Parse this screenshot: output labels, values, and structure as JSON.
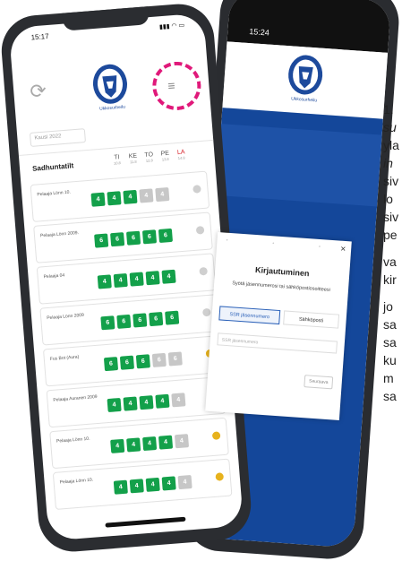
{
  "front_phone": {
    "status_time": "15:17",
    "signal": "...",
    "logo_label": "Ukkosurheilu",
    "menu_icon": "hamburger-menu-icon",
    "refresh_icon": "refresh-icon",
    "season_select": "Kausi 2022",
    "table_title": "Sadhuntatilt",
    "days": [
      {
        "label": "TI",
        "date": "10.8"
      },
      {
        "label": "KE",
        "date": "11.8"
      },
      {
        "label": "TO",
        "date": "12.8"
      },
      {
        "label": "PE",
        "date": "13.8"
      },
      {
        "label": "LA",
        "date": "14.8"
      }
    ],
    "rows": [
      {
        "name": "Pelaaja Lönn 10.",
        "boxes": [
          "4",
          "4",
          "4",
          "4",
          "4"
        ],
        "grey": [
          3,
          4
        ],
        "dot": "grey"
      },
      {
        "name": "Pelaaja Lönn 2009.",
        "boxes": [
          "6",
          "6",
          "6",
          "6",
          "6"
        ],
        "grey": [],
        "dot": "grey"
      },
      {
        "name": "Pelaaja 04",
        "boxes": [
          "4",
          "4",
          "4",
          "4",
          "4"
        ],
        "grey": [],
        "dot": "grey"
      },
      {
        "name": "Pelaaja Lönn 2009",
        "boxes": [
          "6",
          "6",
          "6",
          "6",
          "6"
        ],
        "grey": [],
        "dot": "grey"
      },
      {
        "name": "Fus Bot (Aura)",
        "boxes": [
          "6",
          "6",
          "6",
          "6",
          "6"
        ],
        "grey": [
          3,
          4
        ],
        "dot": "yellow"
      },
      {
        "name": "Pelaaja Auranen 2009",
        "boxes": [
          "4",
          "4",
          "4",
          "4",
          "4"
        ],
        "grey": [
          4
        ],
        "dot": "yellow"
      },
      {
        "name": "Pelaaja Lönn 10.",
        "boxes": [
          "4",
          "4",
          "4",
          "4",
          "4"
        ],
        "grey": [
          4
        ],
        "dot": "yellow"
      },
      {
        "name": "Pelaaja Lönn 10.",
        "boxes": [
          "4",
          "4",
          "4",
          "4",
          "4"
        ],
        "grey": [
          4
        ],
        "dot": "yellow"
      }
    ]
  },
  "back_phone": {
    "status_time": "15:24",
    "logo_label": "Ukkosurheilu"
  },
  "login_modal": {
    "title": "Kirjautuminen",
    "subtitle": "Syötä jäsennumerosi tai sähköpostiosoitteesi",
    "tab_member": "SSR jäsennumero",
    "tab_email": "Sähköposti",
    "field_placeholder": "SSR jäsennumero",
    "submit": "Seuraava",
    "close": "×"
  },
  "side_text": [
    "1.",
    "su",
    "yla",
    "in",
    "siv",
    "lo",
    "siv",
    "pe",
    "va",
    "kir",
    "jo",
    "sa",
    "sa",
    "ku",
    "m",
    "sa"
  ]
}
